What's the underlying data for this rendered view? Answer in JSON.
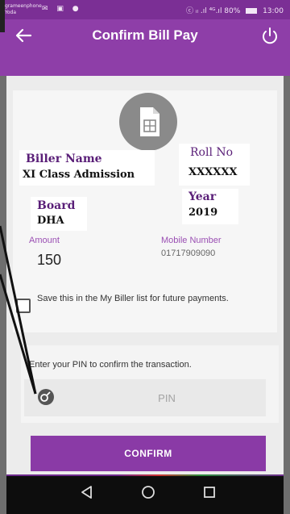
{
  "status_bar": {
    "carrier": "grameenphone Yoda",
    "icons_left": "✉ ▣ ●",
    "signal": "ⓒ ᵢₗ .ıl ⁴ᴳ.ıl 80%",
    "time": "13:00"
  },
  "app_bar": {
    "title": "Confirm Bill Pay",
    "back_icon": "back-arrow-icon",
    "power_icon": "power-icon"
  },
  "bill": {
    "biller_name_label": "Biller Name",
    "biller_name_value": "XI Class Admission",
    "roll_no_label": "Roll No",
    "roll_no_value": "XXXXXX",
    "board_label": "Board",
    "board_value": "DHA",
    "year_label": "Year",
    "year_value": "2019",
    "amount_label": "Amount",
    "amount_value": "150",
    "mobile_label": "Mobile Number",
    "mobile_value": "01717909090"
  },
  "save_option": {
    "checked": false,
    "text": "Save this in the My Biller list for future payments."
  },
  "pin": {
    "instruction": "Enter your PIN to confirm the transaction.",
    "placeholder": "PIN"
  },
  "confirm_label": "CONFIRM",
  "nav": {
    "back": "◁",
    "home": "○",
    "recents": "□"
  },
  "colors": {
    "primary": "#8e3ea8",
    "status_bar": "#7b2f95",
    "label_purple": "#9a4fb3"
  }
}
